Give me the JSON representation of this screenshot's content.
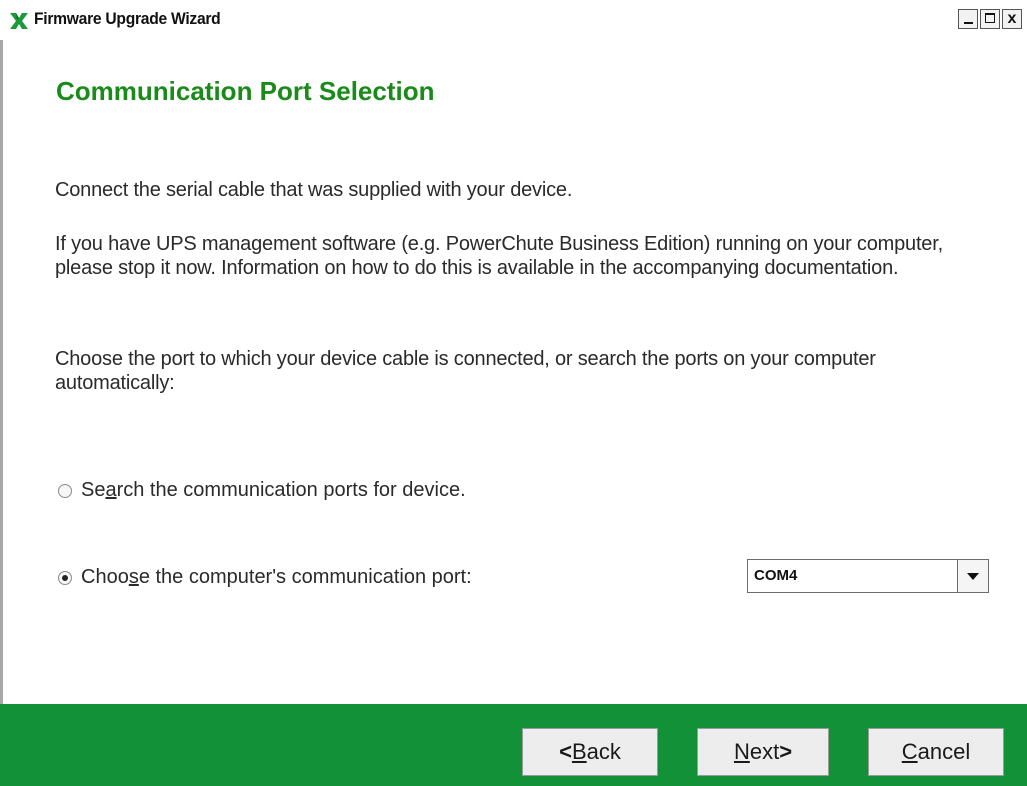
{
  "window": {
    "title": "Firmware Upgrade Wizard",
    "icon": "apc-x-logo-icon",
    "controls": {
      "minimize_icon": "minimize-icon",
      "maximize_icon": "maximize-icon",
      "close_label": "x"
    }
  },
  "page": {
    "heading": "Communication Port Selection",
    "paragraph1": "Connect the serial cable that was supplied with your device.",
    "paragraph2": "If you have UPS management software (e.g. PowerChute Business Edition) running on your computer, please stop it now. Information on how to do this is available in the accompanying documentation.",
    "paragraph3": "Choose the port to which your device cable is connected, or search the ports on your computer automatically:"
  },
  "options": {
    "search": {
      "pre": "Se",
      "mnemonic": "a",
      "post": "rch the communication ports for device.",
      "selected": false
    },
    "choose": {
      "pre": "Choo",
      "mnemonic": "s",
      "post": "e the computer's communication port:",
      "selected": true
    }
  },
  "port_select": {
    "value": "COM4"
  },
  "buttons": {
    "back": {
      "chevron": "<",
      "mnemonic": "B",
      "rest": "ack"
    },
    "next": {
      "mnemonic": "N",
      "rest": "ext",
      "chevron": ">"
    },
    "cancel": {
      "mnemonic": "C",
      "rest": "ancel"
    }
  },
  "colors": {
    "accent_green": "#139139",
    "heading_green": "#1a8a1a"
  }
}
